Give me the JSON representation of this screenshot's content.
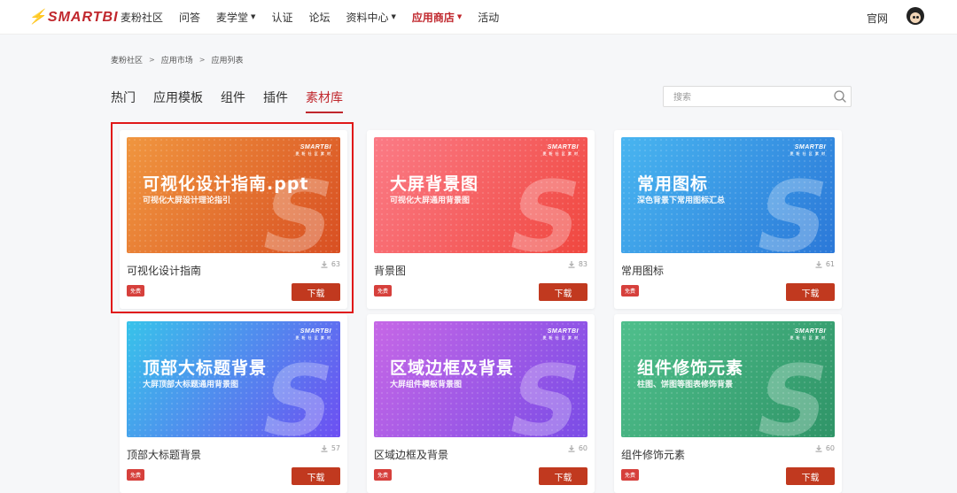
{
  "header": {
    "logo": "SMARTBI",
    "nav": [
      {
        "label": "麦粉社区",
        "dropdown": false,
        "active": false
      },
      {
        "label": "问答",
        "dropdown": false,
        "active": false
      },
      {
        "label": "麦学堂",
        "dropdown": true,
        "active": false
      },
      {
        "label": "认证",
        "dropdown": false,
        "active": false
      },
      {
        "label": "论坛",
        "dropdown": false,
        "active": false
      },
      {
        "label": "资料中心",
        "dropdown": true,
        "active": false
      },
      {
        "label": "应用商店",
        "dropdown": true,
        "active": true
      },
      {
        "label": "活动",
        "dropdown": false,
        "active": false
      }
    ],
    "official_link": "官网",
    "avatar_icon": "user-avatar"
  },
  "breadcrumb": [
    "麦粉社区",
    "应用市场",
    "应用列表"
  ],
  "breadcrumb_sep": ">",
  "tabs": [
    {
      "label": "热门",
      "active": false
    },
    {
      "label": "应用模板",
      "active": false
    },
    {
      "label": "组件",
      "active": false
    },
    {
      "label": "插件",
      "active": false
    },
    {
      "label": "素材库",
      "active": true
    }
  ],
  "search": {
    "placeholder": "搜索",
    "icon": "search-icon"
  },
  "brand_mark": "SMARTBI",
  "brand_sub": "麦 粉 社 区 素 材",
  "cards": [
    {
      "name": "可视化设计指南",
      "downloads": "63",
      "tag": "免费",
      "button": "下载",
      "thumb_title": "可视化设计指南.ppt",
      "thumb_subtitle": "可视化大屏设计理论指引",
      "gradient": [
        "#f0963f",
        "#d84f22"
      ]
    },
    {
      "name": "背景图",
      "downloads": "83",
      "tag": "免费",
      "button": "下载",
      "thumb_title": "大屏背景图",
      "thumb_subtitle": "可视化大屏通用背景图",
      "gradient": [
        "#fb7b86",
        "#f0473f"
      ]
    },
    {
      "name": "常用图标",
      "downloads": "61",
      "tag": "免费",
      "button": "下载",
      "thumb_title": "常用图标",
      "thumb_subtitle": "深色背景下常用图标汇总",
      "gradient": [
        "#48b5f0",
        "#2b78d8"
      ]
    },
    {
      "name": "顶部大标题背景",
      "downloads": "57",
      "tag": "免费",
      "button": "下载",
      "thumb_title": "顶部大标题背景",
      "thumb_subtitle": "大屏顶部大标题通用背景图",
      "gradient": [
        "#37c3ea",
        "#6d4ff2"
      ]
    },
    {
      "name": "区域边框及背景",
      "downloads": "60",
      "tag": "免费",
      "button": "下载",
      "thumb_title": "区域边框及背景",
      "thumb_subtitle": "大屏组件模板背景图",
      "gradient": [
        "#c667e6",
        "#7a4ce6"
      ]
    },
    {
      "name": "组件修饰元素",
      "downloads": "60",
      "tag": "免费",
      "button": "下载",
      "thumb_title": "组件修饰元素",
      "thumb_subtitle": "柱图、饼图等图表修饰背景",
      "gradient": [
        "#4fbf8c",
        "#2f9467"
      ]
    }
  ],
  "colors": {
    "accent": "#c0272d",
    "download_button": "#c1391f",
    "highlight": "#e01818"
  }
}
